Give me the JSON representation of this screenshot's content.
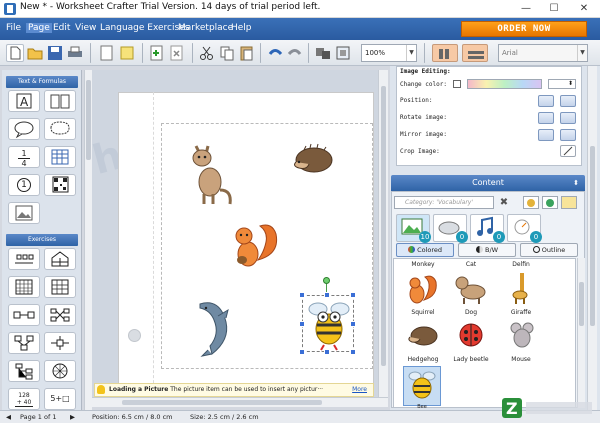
{
  "window": {
    "title": "New * - Worksheet Crafter Trial Version. 14 days of trial period left.",
    "controls": {
      "minimize": "—",
      "maximize": "☐",
      "close": "✕"
    }
  },
  "menu": {
    "items": [
      "File",
      "Page",
      "Edit",
      "View",
      "Language Exercises",
      "Marketplace",
      "Help"
    ],
    "order_button": "ORDER NOW"
  },
  "toolbar": {
    "zoom": "100%",
    "font": "Arial"
  },
  "left_panel": {
    "text_formulas_header": "Text & Formulas",
    "exercises_header": "Exercises",
    "fraction_label": [
      "1",
      "4"
    ],
    "circle_num": "1",
    "exercise_numbers": [
      "128",
      "+ 40",
      "5+□"
    ]
  },
  "image_editing": {
    "header": "Image Editing:",
    "change_color": "Change color:",
    "position": "Position:",
    "rotate": "Rotate image:",
    "mirror": "Mirror image:",
    "crop": "Crop Image:"
  },
  "content_panel": {
    "header": "Content",
    "category_placeholder": "Category: 'Vocabulary'",
    "tab_counts": [
      "10",
      "0",
      "0",
      "0"
    ],
    "filters": [
      "Colored",
      "B/W",
      "Outline"
    ],
    "gallery_labels": [
      "Monkey",
      "Cat",
      "Delfin",
      "Squirrel",
      "Dog",
      "Giraffe",
      "Hedgehog",
      "Lady beetle",
      "Mouse",
      "Bee"
    ]
  },
  "hint": {
    "title": "Loading a Picture",
    "text": "The picture item can be used to insert any pictur···",
    "more": "More"
  },
  "status": {
    "page": "Page 1 of 1",
    "position": "Position: 6.5 cm / 8.0 cm",
    "size": "Size: 2.5 cm / 2.6 cm"
  },
  "colors": {
    "menubar": "#2f63a6",
    "order": "#f58a0a",
    "panel_header": "#3a70b8"
  }
}
